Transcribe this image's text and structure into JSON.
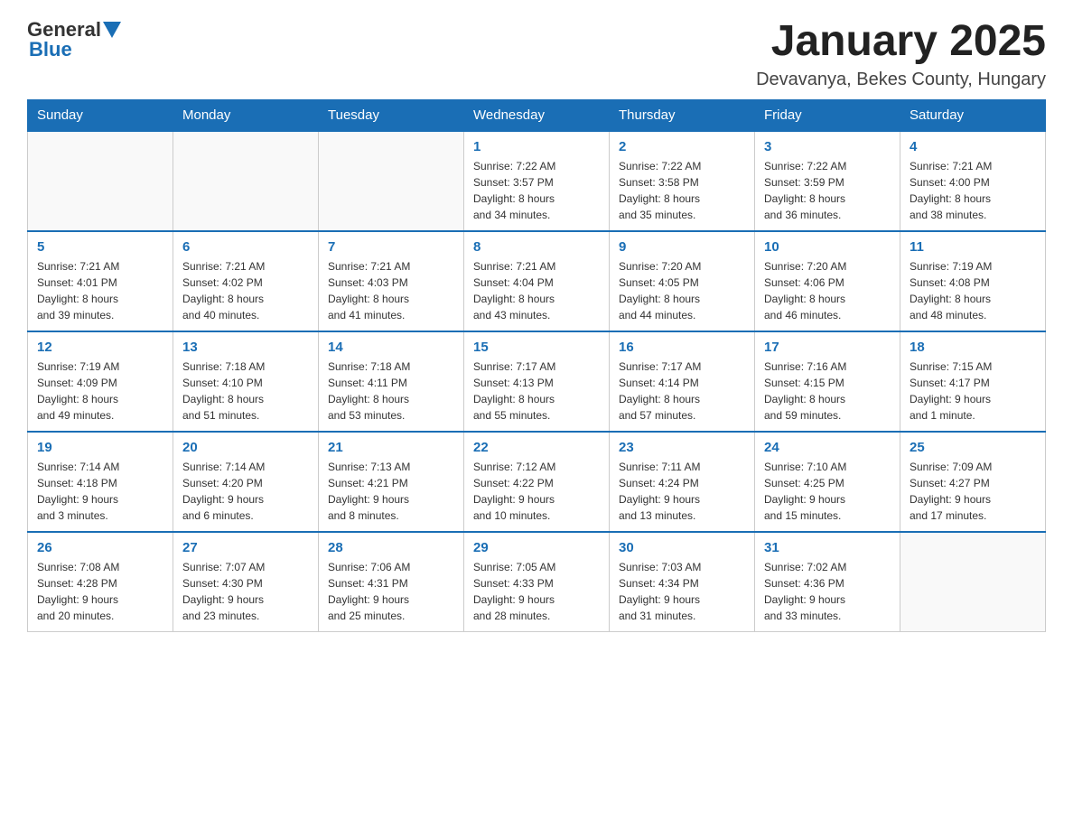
{
  "header": {
    "logo_general": "General",
    "logo_blue": "Blue",
    "month_title": "January 2025",
    "location": "Devavanya, Bekes County, Hungary"
  },
  "weekdays": [
    "Sunday",
    "Monday",
    "Tuesday",
    "Wednesday",
    "Thursday",
    "Friday",
    "Saturday"
  ],
  "weeks": [
    [
      {
        "day": "",
        "info": ""
      },
      {
        "day": "",
        "info": ""
      },
      {
        "day": "",
        "info": ""
      },
      {
        "day": "1",
        "info": "Sunrise: 7:22 AM\nSunset: 3:57 PM\nDaylight: 8 hours\nand 34 minutes."
      },
      {
        "day": "2",
        "info": "Sunrise: 7:22 AM\nSunset: 3:58 PM\nDaylight: 8 hours\nand 35 minutes."
      },
      {
        "day": "3",
        "info": "Sunrise: 7:22 AM\nSunset: 3:59 PM\nDaylight: 8 hours\nand 36 minutes."
      },
      {
        "day": "4",
        "info": "Sunrise: 7:21 AM\nSunset: 4:00 PM\nDaylight: 8 hours\nand 38 minutes."
      }
    ],
    [
      {
        "day": "5",
        "info": "Sunrise: 7:21 AM\nSunset: 4:01 PM\nDaylight: 8 hours\nand 39 minutes."
      },
      {
        "day": "6",
        "info": "Sunrise: 7:21 AM\nSunset: 4:02 PM\nDaylight: 8 hours\nand 40 minutes."
      },
      {
        "day": "7",
        "info": "Sunrise: 7:21 AM\nSunset: 4:03 PM\nDaylight: 8 hours\nand 41 minutes."
      },
      {
        "day": "8",
        "info": "Sunrise: 7:21 AM\nSunset: 4:04 PM\nDaylight: 8 hours\nand 43 minutes."
      },
      {
        "day": "9",
        "info": "Sunrise: 7:20 AM\nSunset: 4:05 PM\nDaylight: 8 hours\nand 44 minutes."
      },
      {
        "day": "10",
        "info": "Sunrise: 7:20 AM\nSunset: 4:06 PM\nDaylight: 8 hours\nand 46 minutes."
      },
      {
        "day": "11",
        "info": "Sunrise: 7:19 AM\nSunset: 4:08 PM\nDaylight: 8 hours\nand 48 minutes."
      }
    ],
    [
      {
        "day": "12",
        "info": "Sunrise: 7:19 AM\nSunset: 4:09 PM\nDaylight: 8 hours\nand 49 minutes."
      },
      {
        "day": "13",
        "info": "Sunrise: 7:18 AM\nSunset: 4:10 PM\nDaylight: 8 hours\nand 51 minutes."
      },
      {
        "day": "14",
        "info": "Sunrise: 7:18 AM\nSunset: 4:11 PM\nDaylight: 8 hours\nand 53 minutes."
      },
      {
        "day": "15",
        "info": "Sunrise: 7:17 AM\nSunset: 4:13 PM\nDaylight: 8 hours\nand 55 minutes."
      },
      {
        "day": "16",
        "info": "Sunrise: 7:17 AM\nSunset: 4:14 PM\nDaylight: 8 hours\nand 57 minutes."
      },
      {
        "day": "17",
        "info": "Sunrise: 7:16 AM\nSunset: 4:15 PM\nDaylight: 8 hours\nand 59 minutes."
      },
      {
        "day": "18",
        "info": "Sunrise: 7:15 AM\nSunset: 4:17 PM\nDaylight: 9 hours\nand 1 minute."
      }
    ],
    [
      {
        "day": "19",
        "info": "Sunrise: 7:14 AM\nSunset: 4:18 PM\nDaylight: 9 hours\nand 3 minutes."
      },
      {
        "day": "20",
        "info": "Sunrise: 7:14 AM\nSunset: 4:20 PM\nDaylight: 9 hours\nand 6 minutes."
      },
      {
        "day": "21",
        "info": "Sunrise: 7:13 AM\nSunset: 4:21 PM\nDaylight: 9 hours\nand 8 minutes."
      },
      {
        "day": "22",
        "info": "Sunrise: 7:12 AM\nSunset: 4:22 PM\nDaylight: 9 hours\nand 10 minutes."
      },
      {
        "day": "23",
        "info": "Sunrise: 7:11 AM\nSunset: 4:24 PM\nDaylight: 9 hours\nand 13 minutes."
      },
      {
        "day": "24",
        "info": "Sunrise: 7:10 AM\nSunset: 4:25 PM\nDaylight: 9 hours\nand 15 minutes."
      },
      {
        "day": "25",
        "info": "Sunrise: 7:09 AM\nSunset: 4:27 PM\nDaylight: 9 hours\nand 17 minutes."
      }
    ],
    [
      {
        "day": "26",
        "info": "Sunrise: 7:08 AM\nSunset: 4:28 PM\nDaylight: 9 hours\nand 20 minutes."
      },
      {
        "day": "27",
        "info": "Sunrise: 7:07 AM\nSunset: 4:30 PM\nDaylight: 9 hours\nand 23 minutes."
      },
      {
        "day": "28",
        "info": "Sunrise: 7:06 AM\nSunset: 4:31 PM\nDaylight: 9 hours\nand 25 minutes."
      },
      {
        "day": "29",
        "info": "Sunrise: 7:05 AM\nSunset: 4:33 PM\nDaylight: 9 hours\nand 28 minutes."
      },
      {
        "day": "30",
        "info": "Sunrise: 7:03 AM\nSunset: 4:34 PM\nDaylight: 9 hours\nand 31 minutes."
      },
      {
        "day": "31",
        "info": "Sunrise: 7:02 AM\nSunset: 4:36 PM\nDaylight: 9 hours\nand 33 minutes."
      },
      {
        "day": "",
        "info": ""
      }
    ]
  ]
}
